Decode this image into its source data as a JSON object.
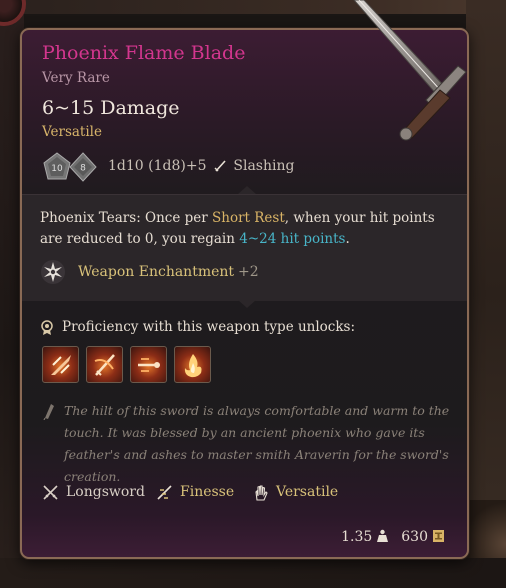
{
  "item": {
    "name": "Phoenix Flame Blade",
    "rarity": "Very Rare",
    "damage": "6~15 Damage",
    "versatile_tag": "Versatile",
    "dice": {
      "die_1": "10",
      "die_2": "8",
      "formula": "1d10 (1d8)+5",
      "damage_type": "Slashing"
    },
    "passive": {
      "title": "Phoenix Tears:",
      "part1": " Once per ",
      "rest_type": "Short Rest",
      "part2": ", when your hit points are reduced to 0, you regain ",
      "heal": "4~24 hit points",
      "part3": "."
    },
    "enchantment": {
      "label": "Weapon Enchantment",
      "bonus": "+2"
    },
    "proficiency_label": "Proficiency with this weapon type unlocks:",
    "unlock_icons": [
      "cleave-icon",
      "lacerate-icon",
      "pommel-strike-icon",
      "flame-icon"
    ],
    "lore": "The hilt of this sword is always comfortable and warm to the touch. It was blessed by an ancient phoenix who gave its feather's and ashes to master smith Araverin for the sword's creation.",
    "properties": [
      "Longsword",
      "Finesse",
      "Versatile"
    ],
    "weight": "1.35",
    "value": "630"
  },
  "colors": {
    "name": "#d3368e",
    "gold_text": "#d9b466",
    "heal_text": "#48b5c8",
    "border": "#8a6a55"
  }
}
